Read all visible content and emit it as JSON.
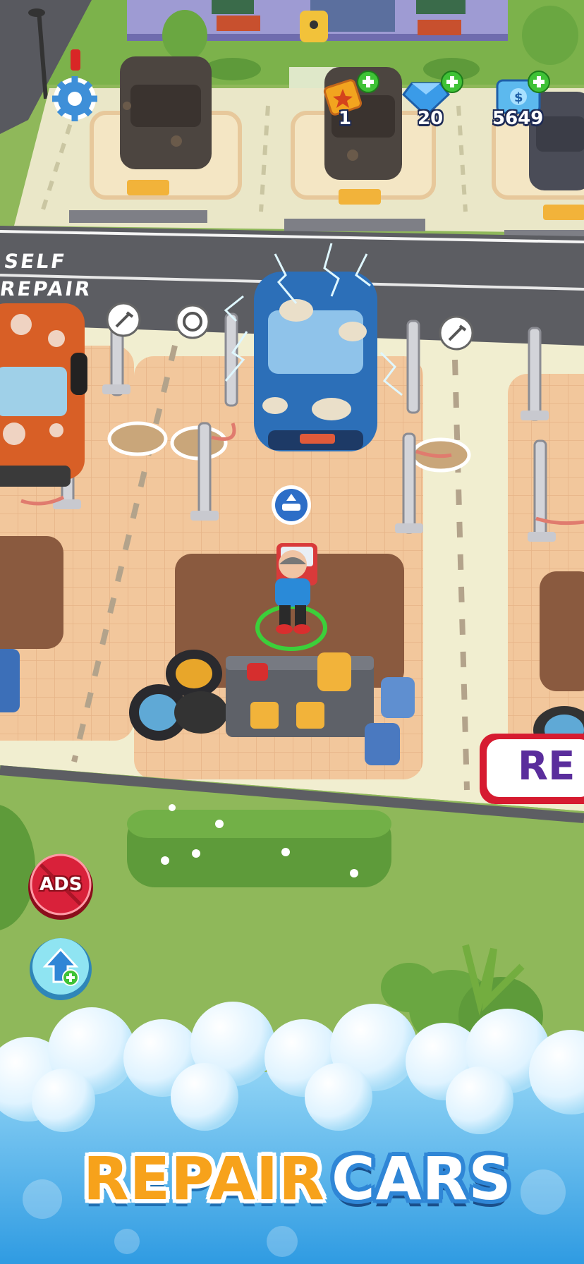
{
  "hud": {
    "tickets": "1",
    "gems": "20",
    "cash": "5649"
  },
  "road_label": {
    "line1": "SELF",
    "line2": "REPAIR"
  },
  "buttons": {
    "ads_label": "ADS"
  },
  "sign": {
    "text": "RE"
  },
  "banner": {
    "word1": "REPAIR",
    "word2": "CARS"
  },
  "icons": {
    "settings": "gear-icon",
    "ticket": "ticket-icon",
    "gem": "gem-icon",
    "cash": "cash-icon",
    "no_ads": "no-ads-icon",
    "upgrade": "upgrade-arrow-icon"
  },
  "colors": {
    "accent_orange": "#f7a21b",
    "accent_blue": "#2f86d6",
    "plus_green": "#3fc236",
    "ads_red": "#d9213a"
  }
}
